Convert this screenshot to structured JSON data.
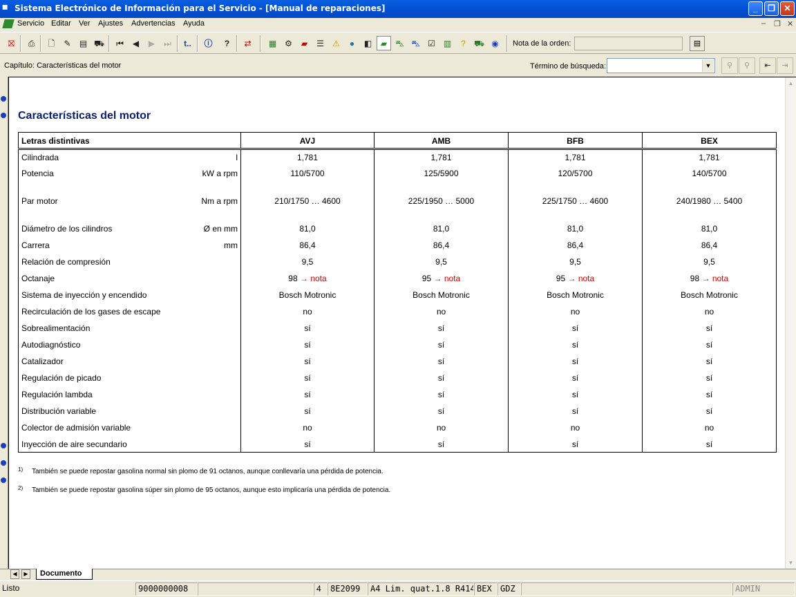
{
  "window": {
    "title": "Sistema Electrónico de Información para el Servicio - [Manual de reparaciones]",
    "app_icon": "vw-audi-icon"
  },
  "menu": [
    "Servicio",
    "Editar",
    "Ver",
    "Ajustes",
    "Advertencias",
    "Ayuda"
  ],
  "toolbar": {
    "order_note_label": "Nota de la orden:",
    "order_note_value": "",
    "link_label": "t.."
  },
  "chapter_bar": {
    "chapter": "Capítulo: Características del motor",
    "search_label": "Término de búsqueda:",
    "search_value": ""
  },
  "document": {
    "title": "Características del motor",
    "table": {
      "header": [
        "Letras distintivas",
        "AVJ",
        "AMB",
        "BFB",
        "BEX"
      ],
      "rows": [
        {
          "label": "Cilindrada",
          "unit": "l",
          "values": [
            "1,781",
            "1,781",
            "1,781",
            "1,781"
          ]
        },
        {
          "label": "Potencia",
          "unit": "kW a rpm",
          "values": [
            "110/5700",
            "125/5900",
            "120/5700",
            "140/5700"
          ]
        },
        {
          "label": "Par motor",
          "unit": "Nm a rpm",
          "values": [
            "210/1750 … 4600",
            "225/1950 … 5000",
            "225/1750 … 4600",
            "240/1980 … 5400"
          ]
        },
        {
          "label": "Diámetro de los cilindros",
          "unit": "Ø en mm",
          "values": [
            "81,0",
            "81,0",
            "81,0",
            "81,0"
          ]
        },
        {
          "label": "Carrera",
          "unit": "mm",
          "values": [
            "86,4",
            "86,4",
            "86,4",
            "86,4"
          ]
        },
        {
          "label": "Relación de compresión",
          "unit": "",
          "values": [
            "9,5",
            "9,5",
            "9,5",
            "9,5"
          ]
        },
        {
          "label": "Octanaje",
          "unit": "",
          "values": [
            "98",
            "95",
            "95",
            "98"
          ],
          "link": "→ nota"
        },
        {
          "label": "Sistema de inyección y encendido",
          "unit": "",
          "values": [
            "Bosch Motronic",
            "Bosch Motronic",
            "Bosch Motronic",
            "Bosch Motronic"
          ]
        },
        {
          "label": "Recirculación de los gases de escape",
          "unit": "",
          "values": [
            "no",
            "no",
            "no",
            "no"
          ]
        },
        {
          "label": "Sobrealimentación",
          "unit": "",
          "values": [
            "sí",
            "sí",
            "sí",
            "sí"
          ]
        },
        {
          "label": "Autodiagnóstico",
          "unit": "",
          "values": [
            "sí",
            "sí",
            "sí",
            "sí"
          ]
        },
        {
          "label": "Catalizador",
          "unit": "",
          "values": [
            "sí",
            "sí",
            "sí",
            "sí"
          ]
        },
        {
          "label": "Regulación de picado",
          "unit": "",
          "values": [
            "sí",
            "sí",
            "sí",
            "sí"
          ]
        },
        {
          "label": "Regulación lambda",
          "unit": "",
          "values": [
            "sí",
            "sí",
            "sí",
            "sí"
          ]
        },
        {
          "label": "Distribución variable",
          "unit": "",
          "values": [
            "sí",
            "sí",
            "sí",
            "sí"
          ]
        },
        {
          "label": "Colector de admisión variable",
          "unit": "",
          "values": [
            "no",
            "no",
            "no",
            "no"
          ]
        },
        {
          "label": "Inyección de aire secundario",
          "unit": "",
          "values": [
            "sí",
            "sí",
            "sí",
            "sí"
          ]
        }
      ]
    },
    "footnotes": [
      {
        "mark": "1)",
        "text": "También se puede repostar gasolina normal sin plomo de 91 octanos, aunque conllevaría una pérdida de potencia."
      },
      {
        "mark": "2)",
        "text": "También se puede repostar gasolina súper sin plomo de 95 octanos, aunque esto implicaría una pérdida de potencia."
      }
    ]
  },
  "tab": {
    "label": "Documento"
  },
  "status": {
    "state": "Listo",
    "order": "9000000008",
    "page": "4",
    "code": "8E2099",
    "model": "A4 Lim. quat.1.8 R414",
    "engine": "BEX",
    "gearbox": "GDZ",
    "user": "ADMIN"
  }
}
